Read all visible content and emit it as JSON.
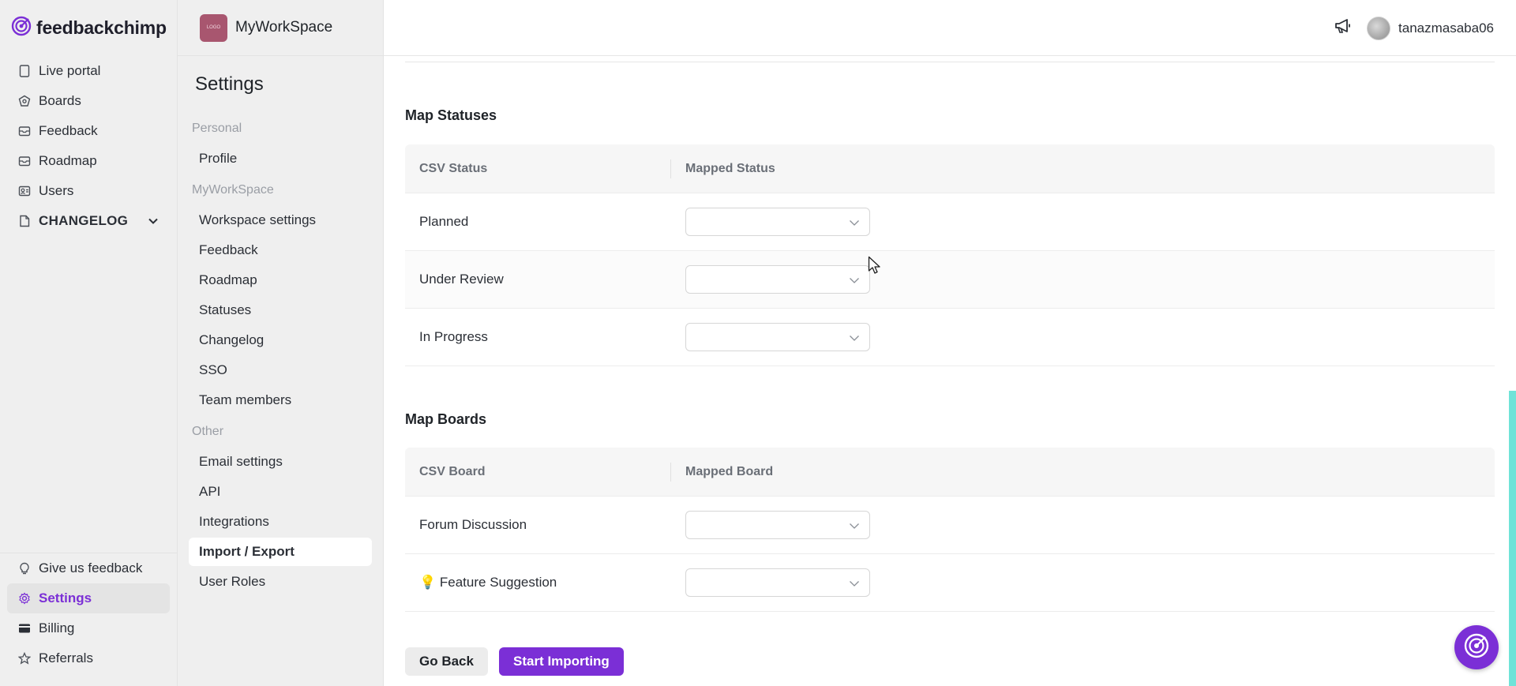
{
  "brand": {
    "name": "feedbackchimp",
    "color": "#7b2fd6"
  },
  "leftnav": {
    "items": [
      {
        "label": "Live portal",
        "icon": "device-icon"
      },
      {
        "label": "Boards",
        "icon": "board-icon"
      },
      {
        "label": "Feedback",
        "icon": "inbox-icon"
      },
      {
        "label": "Roadmap",
        "icon": "map-icon"
      },
      {
        "label": "Users",
        "icon": "users-icon"
      },
      {
        "label": "CHANGELOG",
        "icon": "document-icon"
      }
    ],
    "bottom": [
      {
        "label": "Give us feedback",
        "icon": "bulb-icon"
      },
      {
        "label": "Settings",
        "icon": "gear-icon"
      },
      {
        "label": "Billing",
        "icon": "card-icon"
      },
      {
        "label": "Referrals",
        "icon": "star-icon"
      }
    ]
  },
  "workspace": {
    "name": "MyWorkSpace",
    "logo_text": "LOGO"
  },
  "settings": {
    "title": "Settings",
    "sections": [
      {
        "label": "Personal",
        "items": [
          "Profile"
        ]
      },
      {
        "label": "MyWorkSpace",
        "items": [
          "Workspace settings",
          "Feedback",
          "Roadmap",
          "Statuses",
          "Changelog",
          "SSO",
          "Team members"
        ]
      },
      {
        "label": "Other",
        "items": [
          "Email settings",
          "API",
          "Integrations",
          "Import / Export",
          "User Roles"
        ]
      }
    ],
    "active": "Import / Export"
  },
  "topbar": {
    "username": "tanazmasaba06"
  },
  "map_statuses": {
    "title": "Map Statuses",
    "col1": "CSV Status",
    "col2": "Mapped Status",
    "rows": [
      "Planned",
      "Under Review",
      "In Progress"
    ]
  },
  "map_boards": {
    "title": "Map Boards",
    "col1": "CSV Board",
    "col2": "Mapped Board",
    "rows": [
      "Forum Discussion",
      "💡 Feature Suggestion"
    ]
  },
  "actions": {
    "back": "Go Back",
    "start": "Start Importing"
  }
}
